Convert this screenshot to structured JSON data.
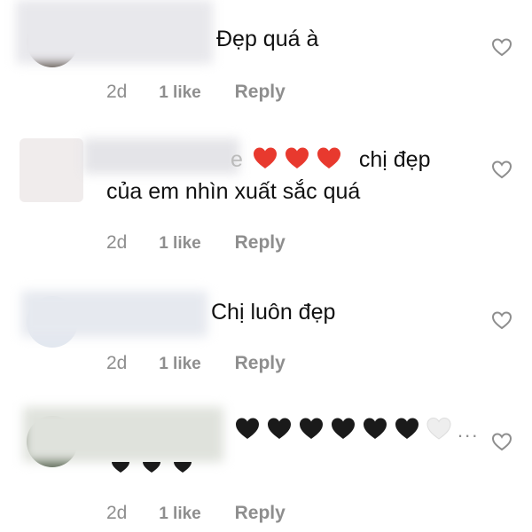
{
  "comments": [
    {
      "text": "Đẹp quá à",
      "time": "2d",
      "likes": "1 like",
      "reply": "Reply"
    },
    {
      "text_suffix": "chị đẹp",
      "text_line2": "của em nhìn xuất sắc quá",
      "leading_char": "e",
      "emojis": [
        "red-heart",
        "red-heart",
        "red-heart"
      ],
      "time": "2d",
      "likes": "1 like",
      "reply": "Reply"
    },
    {
      "text": "Chị luôn đẹp",
      "time": "2d",
      "likes": "1 like",
      "reply": "Reply"
    },
    {
      "emojis": [
        "black-heart",
        "black-heart",
        "black-heart",
        "black-heart",
        "black-heart",
        "black-heart",
        "white-heart"
      ],
      "more": "...",
      "time": "2d",
      "likes": "1 like",
      "reply": "Reply"
    }
  ],
  "colors": {
    "red_heart": "#e8392e",
    "black_heart": "#1a1a1a",
    "white_heart": "#eeeeee",
    "meta_text": "#8e8e8e"
  }
}
